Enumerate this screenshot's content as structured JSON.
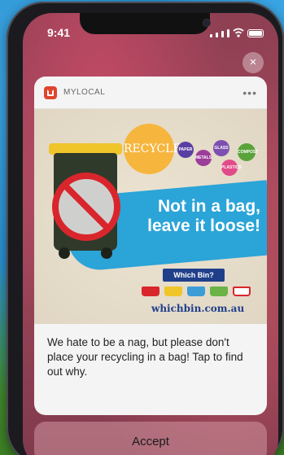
{
  "status_bar": {
    "time": "9:41"
  },
  "notification": {
    "app_name": "MYLOCAL",
    "more_label": "•••",
    "poster": {
      "badge": "RECYCLE",
      "mini_badges": [
        "PAPER",
        "METALS",
        "GLASS",
        "PLASTICS",
        "COMPOST"
      ],
      "headline_line1": "Not in a bag,",
      "headline_line2": "leave it loose!",
      "which_bin": "Which Bin?",
      "website": "whichbin.com.au"
    },
    "message": "We hate to be a nag, but please don't place your recycling in a bag! Tap to find out why."
  },
  "close_label": "×",
  "accept_label": "Accept",
  "colors": {
    "app_icon": "#e0452e",
    "poster_blue": "#2ba4d8",
    "recycle_badge": "#f6b63d",
    "no_sign_red": "#d9262c"
  }
}
